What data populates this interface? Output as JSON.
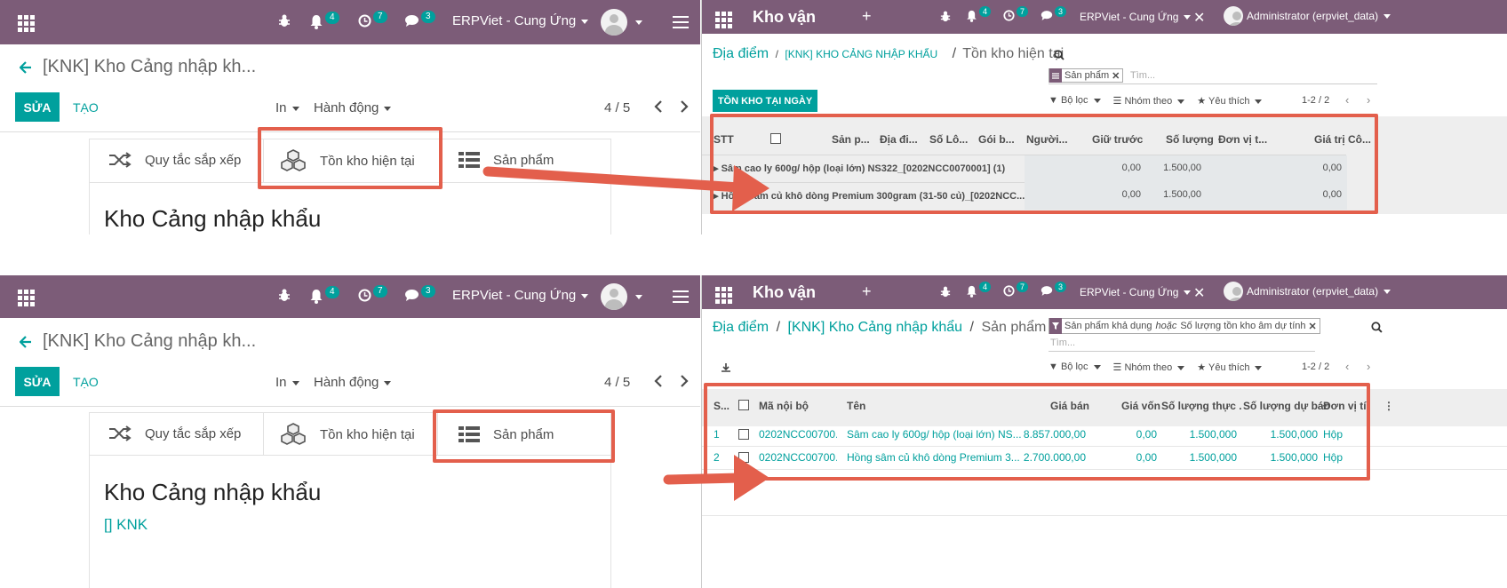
{
  "colors": {
    "brand": "#7c5c78",
    "primary": "#00a09d",
    "highlight": "#e35f4c",
    "badge": "#00a09d"
  },
  "navbar_left": {
    "company": "ERPViet - Cung Ứng",
    "notif_count": "4",
    "activity_count": "7",
    "message_count": "3"
  },
  "navbar_right": {
    "app_title": "Kho vận",
    "notif_count": "4",
    "activity_count": "7",
    "message_count": "3",
    "company": "ERPViet - Cung Ứng",
    "user": "Administrator (erpviet_data)"
  },
  "form": {
    "breadcrumb": "[KNK] Kho Cảng nhập kh...",
    "edit_label": "SỬA",
    "create_label": "TẠO",
    "print_label": "In",
    "action_label": "Hành động",
    "pager": "4 / 5",
    "smart_buttons": {
      "rules": "Quy tắc sắp xếp",
      "stock": "Tồn kho hiện tại",
      "products": "Sản phẩm"
    },
    "title": "Kho Cảng nhập khẩu",
    "short_code": "[] KNK"
  },
  "stock_view": {
    "breadcrumb_root": "Địa điểm",
    "breadcrumb_mid": "[KNK] KHO CẢNG NHẬP KHẨU",
    "breadcrumb_current": "Tồn kho hiện tại",
    "facet": "Sản phẩm",
    "search_placeholder": "Tìm...",
    "stock_at_date_button": "TỒN KHO TẠI NGÀY",
    "filters": "Bộ lọc",
    "group_by": "Nhóm theo",
    "favorites": "Yêu thích",
    "pager": "1-2 / 2",
    "columns": [
      "STT",
      "Sản p...",
      "Địa đi...",
      "Số Lô...",
      "Gói b...",
      "Người...",
      "Giữ trước",
      "Số lượng",
      "Đơn vị t...",
      "Giá trị",
      "Cô..."
    ],
    "groups": [
      {
        "label": "Sâm cao ly 600g/ hộp (loại lớn) NS322_[0202NCC0070001] (1)",
        "reserved": "0,00",
        "quantity": "1.500,00",
        "value": "0,00"
      },
      {
        "label": "Hồng sâm củ khô dòng Premium 300gram (31-50 củ)_[0202NCC...",
        "reserved": "0,00",
        "quantity": "1.500,00",
        "value": "0,00"
      }
    ]
  },
  "product_view": {
    "breadcrumb_root": "Địa điểm",
    "breadcrumb_mid": "[KNK] Kho Cảng nhập khẩu",
    "breadcrumb_current": "Sản phẩm",
    "facet_a": "Sản phẩm khả dụng",
    "facet_or": "hoặc",
    "facet_b": "Số lượng tồn kho âm dự tính",
    "search_placeholder": "Tìm...",
    "filters": "Bộ lọc",
    "group_by": "Nhóm theo",
    "favorites": "Yêu thích",
    "pager": "1-2 / 2",
    "columns": [
      "S...",
      "Mã nội bộ",
      "Tên",
      "Giá bán",
      "Giá vốn",
      "Số lượng thực ...",
      "Số lượng dự báo",
      "Đơn vị tí..."
    ],
    "rows": [
      {
        "seq": "1",
        "code": "0202NCC00700...",
        "name": "Sâm cao ly 600g/ hộp (loại lớn) NS...",
        "price": "8.857.000,00",
        "cost": "0,00",
        "qty": "1.500,000",
        "forecast": "1.500,000",
        "uom": "Hộp"
      },
      {
        "seq": "2",
        "code": "0202NCC00700...",
        "name": "Hồng sâm củ khô dòng Premium 3...",
        "price": "2.700.000,00",
        "cost": "0,00",
        "qty": "1.500,000",
        "forecast": "1.500,000",
        "uom": "Hộp"
      }
    ]
  }
}
